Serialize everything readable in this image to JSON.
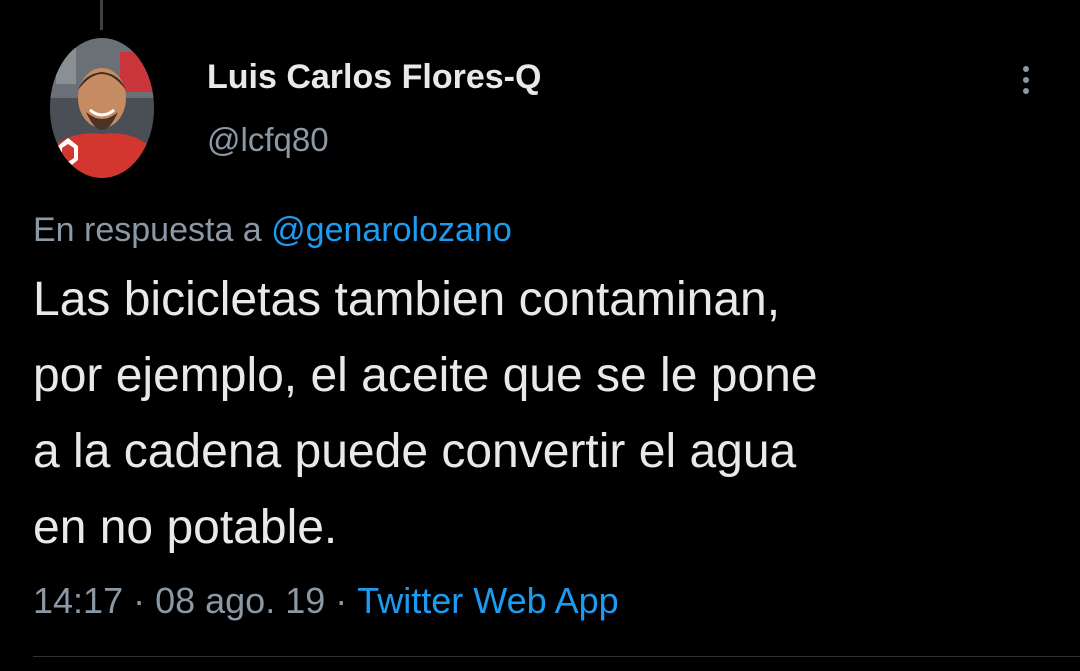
{
  "tweet": {
    "author": {
      "display_name": "Luis Carlos Flores-Q",
      "handle": "@lcfq80",
      "avatar_icon": "profile-photo"
    },
    "more_icon": "more-vertical-icon",
    "reply_context": {
      "prefix": "En respuesta a",
      "mention": "@genarolozano"
    },
    "text_lines": [
      "Las bicicletas tambien contaminan,",
      "por ejemplo, el aceite que se le pone",
      "a la cadena puede convertir el agua",
      "en no potable."
    ],
    "meta": {
      "time": "14:17",
      "separator": "·",
      "date": "08 ago. 19",
      "source": "Twitter Web App"
    }
  },
  "colors": {
    "background": "#000000",
    "primary_text": "#e7e9ea",
    "secondary_text": "#8b98a5",
    "accent": "#1d9bf0",
    "thread_line": "#3e4144",
    "divider": "#2f3336"
  }
}
